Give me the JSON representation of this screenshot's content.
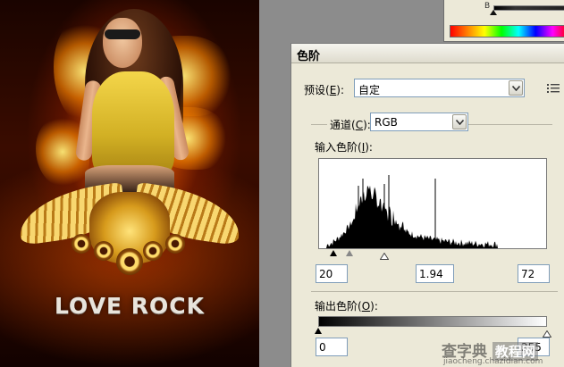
{
  "poster": {
    "logo_text": "LOVE ROCK"
  },
  "color_panel": {
    "channel_label": "B"
  },
  "levels_dialog": {
    "title": "色阶",
    "preset": {
      "label": "预设(",
      "hotkey": "E",
      "label_end": "):",
      "value": "自定"
    },
    "channel": {
      "label": "通道(",
      "hotkey": "C",
      "label_end": "):",
      "value": "RGB"
    },
    "input_levels": {
      "label": "输入色阶(",
      "hotkey": "I",
      "label_end": "):",
      "black": "20",
      "gamma": "1.94",
      "white": "72"
    },
    "output_levels": {
      "label": "输出色阶(",
      "hotkey": "O",
      "label_end": "):",
      "black": "0",
      "white": "255"
    }
  },
  "watermark": {
    "text_cn": "查字典",
    "text_cn2": "教程网",
    "url": "jiaocheng.chazidian.com"
  },
  "colors": {
    "dialog_bg": "#ece9d8",
    "input_border": "#7f9db9"
  }
}
